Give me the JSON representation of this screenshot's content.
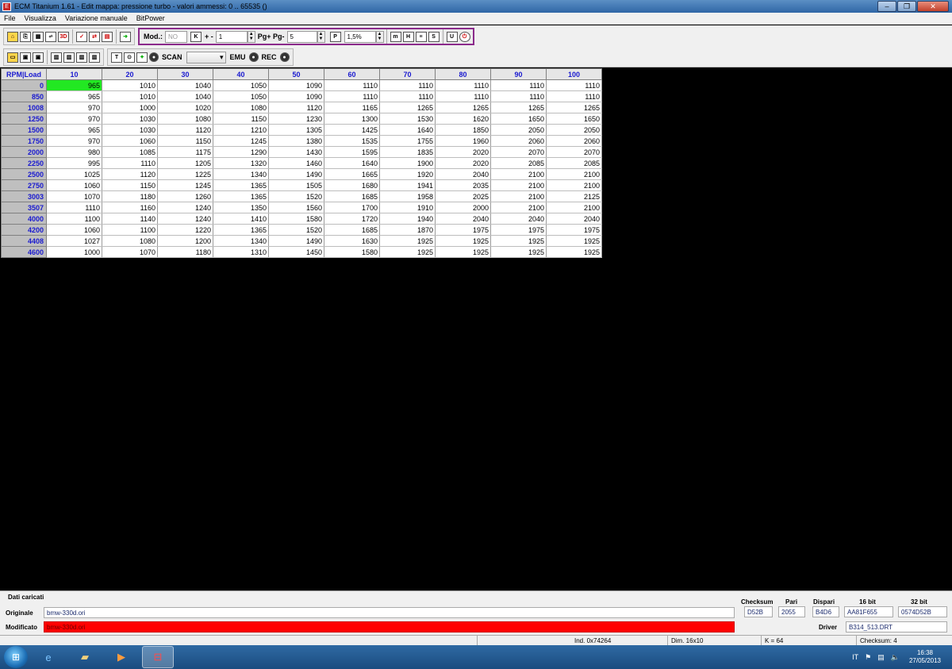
{
  "window": {
    "title": "ECM Titanium 1.61 - Edit mappa: pressione turbo - valori ammessi: 0 .. 65535 ()",
    "icon_label": "E"
  },
  "menu": [
    "File",
    "Visualizza",
    "Variazione manuale",
    "BitPower"
  ],
  "toolbar": {
    "mod_label": "Mod.:",
    "mod_value": "NO",
    "k_icon": "K",
    "plusminus_label": "+ -",
    "plusminus_value": "1",
    "pg_label": "Pg+ Pg-",
    "pg_value": "5",
    "p_icon": "P",
    "percent_value": "1,5%",
    "scan_label": "SCAN",
    "emu_label": "EMU",
    "rec_label": "REC"
  },
  "map": {
    "corner": "RPM|Load",
    "columns": [
      "10",
      "20",
      "30",
      "40",
      "50",
      "60",
      "70",
      "80",
      "90",
      "100"
    ],
    "rows": [
      {
        "rpm": "0",
        "values": [
          "965",
          "1010",
          "1040",
          "1050",
          "1090",
          "1110",
          "1110",
          "1110",
          "1110",
          "1110"
        ]
      },
      {
        "rpm": "850",
        "values": [
          "965",
          "1010",
          "1040",
          "1050",
          "1090",
          "1110",
          "1110",
          "1110",
          "1110",
          "1110"
        ]
      },
      {
        "rpm": "1008",
        "values": [
          "970",
          "1000",
          "1020",
          "1080",
          "1120",
          "1165",
          "1265",
          "1265",
          "1265",
          "1265"
        ]
      },
      {
        "rpm": "1250",
        "values": [
          "970",
          "1030",
          "1080",
          "1150",
          "1230",
          "1300",
          "1530",
          "1620",
          "1650",
          "1650"
        ]
      },
      {
        "rpm": "1500",
        "values": [
          "965",
          "1030",
          "1120",
          "1210",
          "1305",
          "1425",
          "1640",
          "1850",
          "2050",
          "2050"
        ]
      },
      {
        "rpm": "1750",
        "values": [
          "970",
          "1060",
          "1150",
          "1245",
          "1380",
          "1535",
          "1755",
          "1960",
          "2060",
          "2060"
        ]
      },
      {
        "rpm": "2000",
        "values": [
          "980",
          "1085",
          "1175",
          "1290",
          "1430",
          "1595",
          "1835",
          "2020",
          "2070",
          "2070"
        ]
      },
      {
        "rpm": "2250",
        "values": [
          "995",
          "1110",
          "1205",
          "1320",
          "1460",
          "1640",
          "1900",
          "2020",
          "2085",
          "2085"
        ]
      },
      {
        "rpm": "2500",
        "values": [
          "1025",
          "1120",
          "1225",
          "1340",
          "1490",
          "1665",
          "1920",
          "2040",
          "2100",
          "2100"
        ]
      },
      {
        "rpm": "2750",
        "values": [
          "1060",
          "1150",
          "1245",
          "1365",
          "1505",
          "1680",
          "1941",
          "2035",
          "2100",
          "2100"
        ]
      },
      {
        "rpm": "3003",
        "values": [
          "1070",
          "1180",
          "1260",
          "1365",
          "1520",
          "1685",
          "1958",
          "2025",
          "2100",
          "2125"
        ]
      },
      {
        "rpm": "3507",
        "values": [
          "1110",
          "1160",
          "1240",
          "1350",
          "1560",
          "1700",
          "1910",
          "2000",
          "2100",
          "2100"
        ]
      },
      {
        "rpm": "4000",
        "values": [
          "1100",
          "1140",
          "1240",
          "1410",
          "1580",
          "1720",
          "1940",
          "2040",
          "2040",
          "2040"
        ]
      },
      {
        "rpm": "4200",
        "values": [
          "1060",
          "1100",
          "1220",
          "1365",
          "1520",
          "1685",
          "1870",
          "1975",
          "1975",
          "1975"
        ]
      },
      {
        "rpm": "4408",
        "values": [
          "1027",
          "1080",
          "1200",
          "1340",
          "1490",
          "1630",
          "1925",
          "1925",
          "1925",
          "1925"
        ]
      },
      {
        "rpm": "4600",
        "values": [
          "1000",
          "1070",
          "1180",
          "1310",
          "1450",
          "1580",
          "1925",
          "1925",
          "1925",
          "1925"
        ]
      }
    ],
    "selected_color": "#22e822"
  },
  "bottom": {
    "loaded_label": "Dati caricati",
    "original_label": "Originale",
    "original_value": "bmw-330d.ori",
    "modified_label": "Modificato",
    "modified_value": "bmw-330d.ori",
    "checksum_label": "Checksum",
    "pari_label": "Pari",
    "dispari_label": "Dispari",
    "bit16_label": "16 bit",
    "bit32_label": "32 bit",
    "checksum_value": "D52B",
    "pari_value": "2055",
    "dispari_value": "B4D6",
    "bit16_value": "AA81F655",
    "bit32_value": "0574D52B",
    "driver_label": "Driver",
    "driver_value": "B314_513.DRT"
  },
  "status": {
    "ind": "Ind. 0x74264",
    "dim": "Dim. 16x10",
    "k": "K = 64",
    "checksum": "Checksum: 4"
  },
  "taskbar": {
    "lang": "IT",
    "time": "16:38",
    "date": "27/05/2013"
  }
}
